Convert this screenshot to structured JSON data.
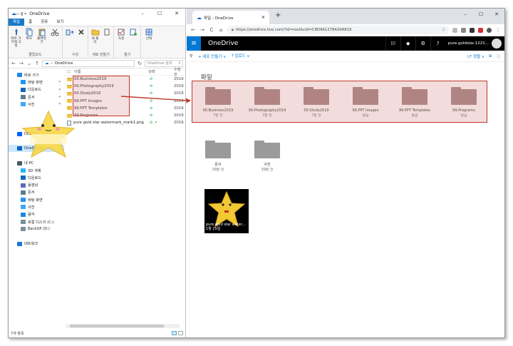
{
  "explorer": {
    "title": "OneDrive",
    "ribbon_tabs": [
      "파일",
      "홈",
      "공유",
      "보기"
    ],
    "ribbon": {
      "clipboard_buttons": [
        "바로 가기에 고정",
        "복사",
        "붙여넣기"
      ],
      "clipboard_label": "클립보드",
      "organize_label": "구성",
      "new_button": "새 폴더",
      "new_label": "새로 만들기",
      "open_button": "속성",
      "open_label": "열기",
      "select_button": "선택"
    },
    "address": "OneDrive",
    "search_placeholder": "OneDrive 검색",
    "nav_items": [
      {
        "label": "바로 가기",
        "pinned": false
      },
      {
        "label": "바탕 화면",
        "pinned": true
      },
      {
        "label": "다운로드",
        "pinned": true
      },
      {
        "label": "문서",
        "pinned": true
      },
      {
        "label": "사진",
        "pinned": true
      },
      {
        "label": "",
        "pinned": false
      },
      {
        "label": "",
        "pinned": false
      },
      {
        "label": "",
        "pinned": false
      },
      {
        "label": "Dropbox",
        "pinned": false
      },
      {
        "label": "",
        "pinned": false
      },
      {
        "label": "OneDrive",
        "pinned": false
      },
      {
        "label": "",
        "pinned": false
      },
      {
        "label": "내 PC",
        "pinned": false
      },
      {
        "label": "3D 개체",
        "pinned": false
      },
      {
        "label": "다운로드",
        "pinned": false
      },
      {
        "label": "동영상",
        "pinned": false
      },
      {
        "label": "문서",
        "pinned": false
      },
      {
        "label": "바탕 화면",
        "pinned": false
      },
      {
        "label": "사진",
        "pinned": false
      },
      {
        "label": "음악",
        "pinned": false
      },
      {
        "label": "로컬 디스크 (C:)",
        "pinned": false
      },
      {
        "label": "BackUP (D:)",
        "pinned": false
      },
      {
        "label": "",
        "pinned": false
      },
      {
        "label": "네트워크",
        "pinned": false
      }
    ],
    "columns": {
      "name": "이름",
      "status": "상태",
      "date": "수정한"
    },
    "files": [
      {
        "name": "00.Business2019",
        "status": "⊘",
        "date": "2019-",
        "type": "folder"
      },
      {
        "name": "00.Photography2019",
        "status": "⊘",
        "date": "2019-",
        "type": "folder"
      },
      {
        "name": "00.Study2019",
        "status": "⊘",
        "date": "2019-",
        "type": "folder"
      },
      {
        "name": "99.PPT Images",
        "status": "⊘",
        "date": "2019-",
        "type": "folder"
      },
      {
        "name": "99.PPT Templates",
        "status": "⊘",
        "date": "2019-",
        "type": "folder"
      },
      {
        "name": "99.Programs",
        "status": "⊘",
        "date": "2019-",
        "type": "folder"
      },
      {
        "name": "pure gold star watermark_mark1.png",
        "status": "⊘ ↗",
        "date": "2019-",
        "type": "png"
      }
    ],
    "status_bar": "7개 항목"
  },
  "browser": {
    "tab_title": "파일 - OneDrive",
    "url": "https://onedrive.live.com/?id=root&cid=C8D9A1278420A819",
    "header": {
      "brand": "OneDrive",
      "user": "pure.goldstar.1221..."
    },
    "command_bar": {
      "new_label": "+ 새로 만들기 ∨",
      "upload_label": "⤒ 업로드 ∨",
      "sort_label": "⇂F 정렬 ∨"
    },
    "page_title": "파일",
    "folders_top": [
      {
        "name": "00.Business2019",
        "date": "7분 전"
      },
      {
        "name": "00.Photography2019",
        "date": "7분 전"
      },
      {
        "name": "00.Study2019",
        "date": "7분 전"
      },
      {
        "name": "99.PPT Images",
        "date": "방금"
      },
      {
        "name": "99.PPT Templates",
        "date": "방금"
      },
      {
        "name": "99.Programs",
        "date": "방금"
      }
    ],
    "folders_bottom": [
      {
        "name": "문서",
        "date": "39분 전"
      },
      {
        "name": "사진",
        "date": "39분 전"
      }
    ],
    "photo": {
      "name": "pure gold star water...",
      "date": "1월 25일"
    }
  },
  "colors": {
    "accent": "#0078d4",
    "highlight_border": "#c0392b",
    "folder_highlight": "#a68585",
    "folder_gray": "#9a9a9a",
    "ribbon_file_tab": "#1979ca"
  }
}
